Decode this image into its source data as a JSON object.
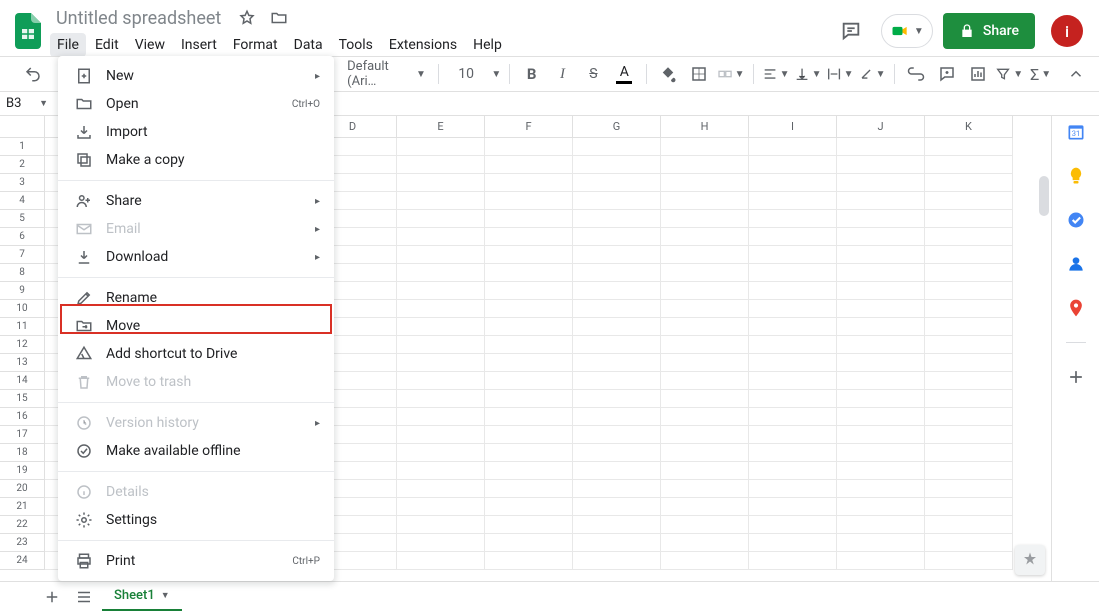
{
  "doc": {
    "title": "Untitled spreadsheet"
  },
  "menu": {
    "file": "File",
    "edit": "Edit",
    "view": "View",
    "insert": "Insert",
    "format": "Format",
    "data": "Data",
    "tools": "Tools",
    "extensions": "Extensions",
    "help": "Help"
  },
  "toolbar": {
    "font": "Default (Ari…",
    "font_size": "10"
  },
  "share": {
    "label": "Share"
  },
  "avatar": {
    "initial": "i"
  },
  "name_box": {
    "ref": "B3"
  },
  "columns": [
    "D",
    "E",
    "F",
    "G",
    "H",
    "I",
    "J",
    "K"
  ],
  "rows": [
    "1",
    "2",
    "3",
    "4",
    "5",
    "6",
    "7",
    "8",
    "9",
    "10",
    "11",
    "12",
    "13",
    "14",
    "15",
    "16",
    "17",
    "18",
    "19",
    "20",
    "21",
    "22",
    "23",
    "24"
  ],
  "sheet_tab": {
    "name": "Sheet1"
  },
  "file_menu": {
    "new": "New",
    "open": "Open",
    "open_shortcut": "Ctrl+O",
    "import": "Import",
    "make_copy": "Make a copy",
    "share_item": "Share",
    "email": "Email",
    "download": "Download",
    "rename": "Rename",
    "move": "Move",
    "shortcut": "Add shortcut to Drive",
    "trash": "Move to trash",
    "version": "Version history",
    "offline": "Make available offline",
    "details": "Details",
    "settings": "Settings",
    "print": "Print",
    "print_shortcut": "Ctrl+P"
  }
}
